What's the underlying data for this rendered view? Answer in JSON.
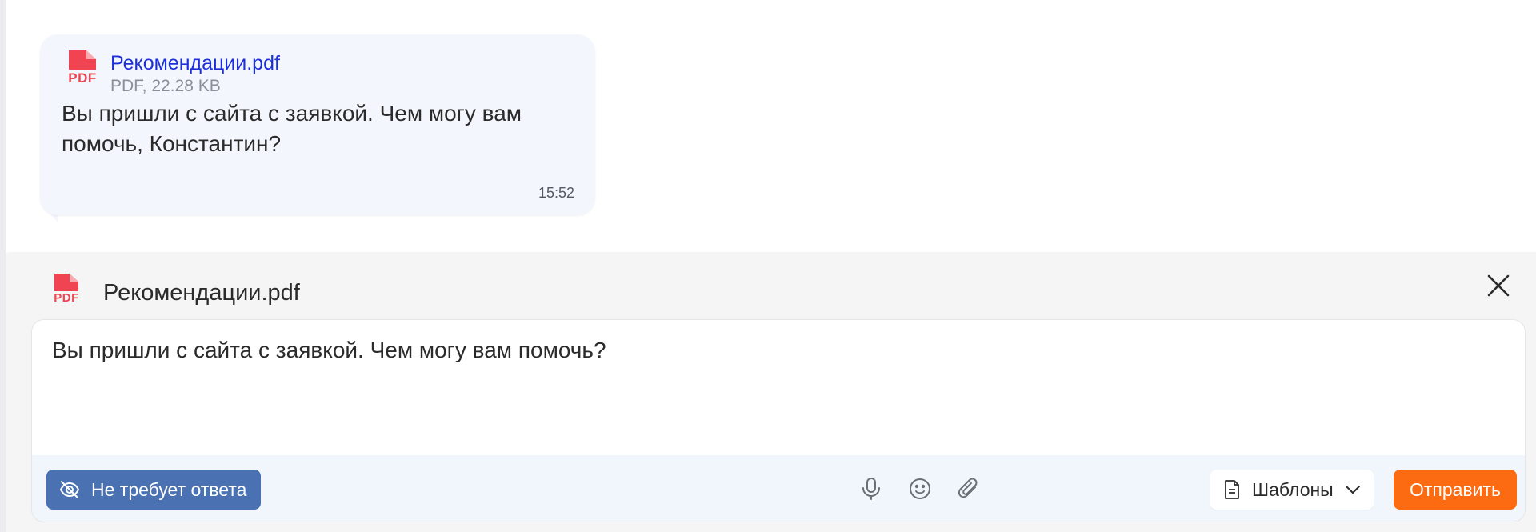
{
  "message": {
    "attachment": {
      "icon": "pdf-file-icon",
      "type_label": "PDF",
      "file_name": "Рекомендации.pdf",
      "file_info": "PDF, 22.28 KB"
    },
    "text": "Вы пришли с сайта с заявкой. Чем могу вам помочь, Константин?",
    "time": "15:52"
  },
  "composer": {
    "attachment": {
      "icon": "pdf-file-icon",
      "type_label": "PDF",
      "file_name": "Рекомендации.pdf"
    },
    "input_value": "Вы пришли с сайта с заявкой. Чем могу вам помочь?",
    "no_reply_label": "Не требует ответа",
    "templates_label": "Шаблоны",
    "send_label": "Отправить"
  },
  "colors": {
    "bubble_bg": "#f3f7fd",
    "link": "#1d2fd8",
    "pdf_red": "#f04452",
    "no_reply_bg": "#4a72b3",
    "send_bg": "#fc6a12",
    "panel_bg": "#f5f5f6"
  }
}
